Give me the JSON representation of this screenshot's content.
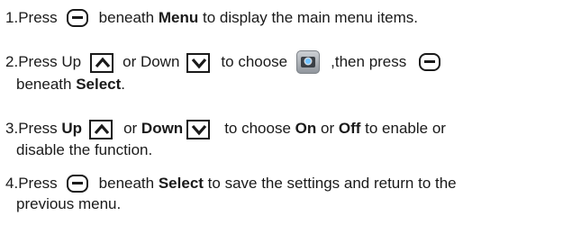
{
  "steps": [
    {
      "n": "1.",
      "a": "Press",
      "b": "beneath",
      "c": "Menu",
      "d": "to display the main menu items."
    },
    {
      "n": "2.",
      "a": "Press Up",
      "b": "or Down",
      "c": "to choose",
      "d": ",then press",
      "e": "beneath",
      "f": "Select",
      "g": "."
    },
    {
      "n": "3.",
      "a": "Press",
      "b": "Up",
      "c": "or",
      "d": "Down",
      "e": "to choose",
      "f": "On",
      "g": "or",
      "h": "Off",
      "i": "to enable or",
      "j": "disable the function."
    },
    {
      "n": "4.",
      "a": "Press",
      "b": "beneath",
      "c": "Select",
      "d": "to save the settings and return to the",
      "e": "previous menu."
    }
  ],
  "icons": {
    "softkey": "softkey-minus-icon",
    "up": "up-arrow-key-icon",
    "down": "down-arrow-key-icon",
    "app": "camera-app-icon"
  }
}
